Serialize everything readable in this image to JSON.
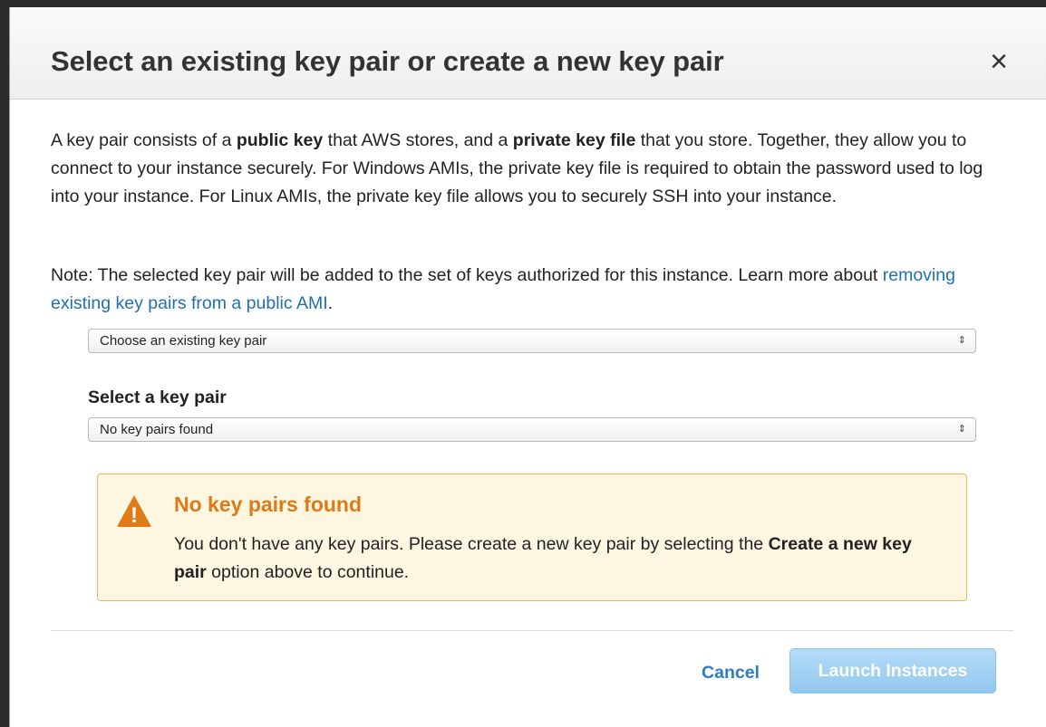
{
  "dialog": {
    "title": "Select an existing key pair or create a new key pair",
    "close_label": "×"
  },
  "description": {
    "part1": "A key pair consists of a ",
    "bold1": "public key",
    "part2": " that AWS stores, and a ",
    "bold2": "private key file",
    "part3": " that you store. Together, they allow you to connect to your instance securely. For Windows AMIs, the private key file is required to obtain the password used to log into your instance. For Linux AMIs, the private key file allows you to securely SSH into your instance."
  },
  "note": {
    "prefix": "Note: The selected key pair will be added to the set of keys authorized for this instance. Learn more about ",
    "link_text": "removing existing key pairs from a public AMI",
    "suffix": "."
  },
  "key_pair_mode_select": {
    "selected": "Choose an existing key pair",
    "arrows": "⇕"
  },
  "key_pair_select": {
    "label": "Select a key pair",
    "selected": "No key pairs found",
    "arrows": "⇕"
  },
  "alert": {
    "title": "No key pairs found",
    "body_prefix": "You don't have any key pairs. Please create a new key pair by selecting the ",
    "body_bold": "Create a new key pair",
    "body_suffix": " option above to continue.",
    "icon": "warning-icon",
    "icon_glyph": "!",
    "color_title": "#dd7a17",
    "color_background": "#fdf6e0"
  },
  "footer": {
    "cancel_label": "Cancel",
    "launch_label": "Launch Instances",
    "launch_enabled": false
  }
}
